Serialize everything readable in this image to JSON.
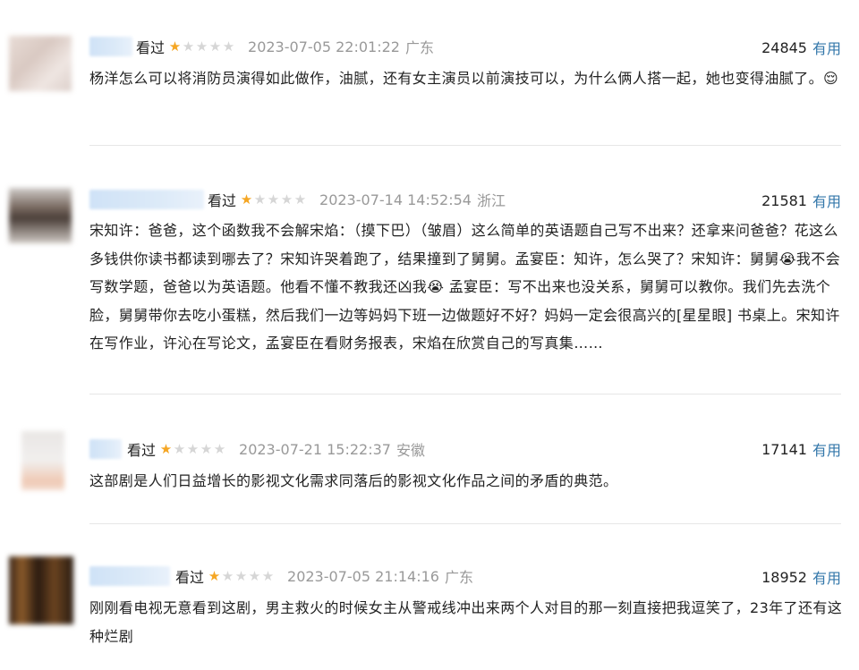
{
  "comments": [
    {
      "watched_label": "看过",
      "rating": 1,
      "timestamp": "2023-07-05 22:01:22",
      "location": "广东",
      "vote_count": "24845",
      "useful_label": "有用",
      "text": "杨洋怎么可以将消防员演得如此做作，油腻，还有女主演员以前演技可以，为什么俩人搭一起，她也变得油腻了。😌"
    },
    {
      "watched_label": "看过",
      "rating": 1,
      "timestamp": "2023-07-14 14:52:54",
      "location": "浙江",
      "vote_count": "21581",
      "useful_label": "有用",
      "text": "宋知许：爸爸，这个函数我不会解宋焰：（摸下巴）（皱眉）这么简单的英语题自己写不出来？还拿来问爸爸？花这么多钱供你读书都读到哪去了？宋知许哭着跑了，结果撞到了舅舅。孟宴臣：知许，怎么哭了？宋知许：舅舅😭我不会写数学题，爸爸以为英语题。他看不懂不教我还凶我😭 孟宴臣：写不出来也没关系，舅舅可以教你。我们先去洗个脸，舅舅带你去吃小蛋糕，然后我们一边等妈妈下班一边做题好不好？妈妈一定会很高兴的[星星眼] 书桌上。宋知许在写作业，许沁在写论文，孟宴臣在看财务报表，宋焰在欣赏自己的写真集……"
    },
    {
      "watched_label": "看过",
      "rating": 1,
      "timestamp": "2023-07-21 15:22:37",
      "location": "安徽",
      "vote_count": "17141",
      "useful_label": "有用",
      "text": "这部剧是人们日益增长的影视文化需求同落后的影视文化作品之间的矛盾的典范。"
    },
    {
      "watched_label": "看过",
      "rating": 1,
      "timestamp": "2023-07-05 21:14:16",
      "location": "广东",
      "vote_count": "18952",
      "useful_label": "有用",
      "text": "刚刚看电视无意看到这剧，男主救火的时候女主从警戒线冲出来两个人对目的那一刻直接把我逗笑了，23年了还有这种烂剧"
    }
  ],
  "colors": {
    "star_on": "#f5a623",
    "star_off": "#d6d6d6",
    "link": "#3377aa",
    "meta": "#999999"
  }
}
